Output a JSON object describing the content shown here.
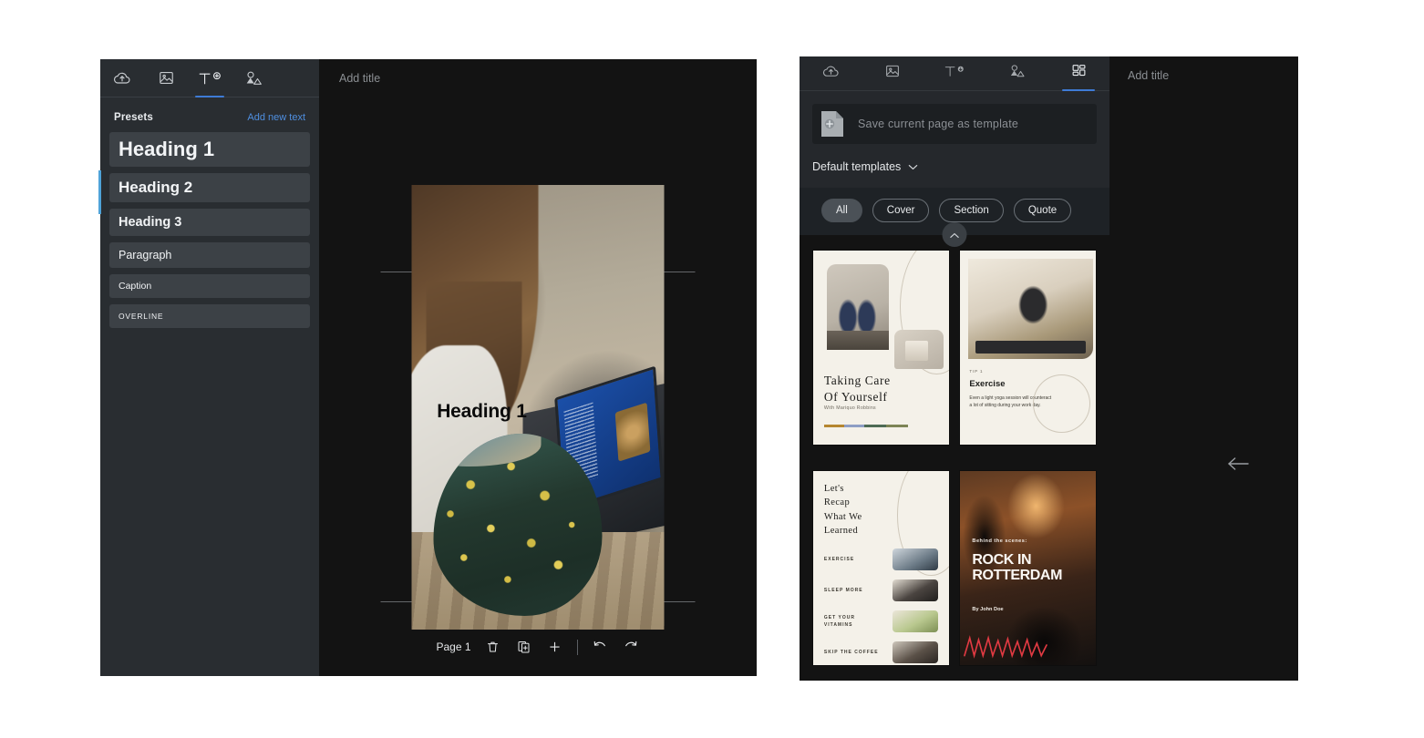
{
  "left_editor": {
    "tabs": [
      {
        "id": "upload",
        "icon": "cloud-upload-icon",
        "active": false
      },
      {
        "id": "images",
        "icon": "image-icon",
        "active": false
      },
      {
        "id": "text",
        "icon": "text-add-icon",
        "active": true
      },
      {
        "id": "shapes",
        "icon": "shapes-icon",
        "active": false
      }
    ],
    "presets_header": {
      "title": "Presets",
      "add_link": "Add new text"
    },
    "presets": [
      {
        "label": "Heading 1",
        "style": "h1"
      },
      {
        "label": "Heading 2",
        "style": "h2"
      },
      {
        "label": "Heading 3",
        "style": "h3"
      },
      {
        "label": "Paragraph",
        "style": "para"
      },
      {
        "label": "Caption",
        "style": "caption"
      },
      {
        "label": "OVERLINE",
        "style": "overline"
      }
    ],
    "canvas": {
      "title_placeholder": "Add title",
      "overlay_heading": "Heading 1"
    },
    "bottom_toolbar": {
      "page_label": "Page 1",
      "delete_icon": "trash-icon",
      "duplicate_icon": "duplicate-page-icon",
      "add_icon": "plus-icon",
      "undo_icon": "undo-icon",
      "redo_icon": "redo-icon"
    }
  },
  "right_editor": {
    "tabs": [
      {
        "id": "upload",
        "icon": "cloud-upload-icon",
        "active": false
      },
      {
        "id": "images",
        "icon": "image-icon",
        "active": false
      },
      {
        "id": "text",
        "icon": "text-download-icon",
        "active": false
      },
      {
        "id": "shapes",
        "icon": "shapes-icon",
        "active": false
      },
      {
        "id": "templates",
        "icon": "grid-templates-icon",
        "active": true
      }
    ],
    "save_row": {
      "icon": "document-plus-icon",
      "label": "Save current page as template"
    },
    "default_templates": {
      "label": "Default templates",
      "chevron": "chevron-down-icon"
    },
    "filters": [
      {
        "label": "All",
        "active": true
      },
      {
        "label": "Cover",
        "active": false
      },
      {
        "label": "Section",
        "active": false
      },
      {
        "label": "Quote",
        "active": false
      }
    ],
    "collapse_button": "chevron-up-icon",
    "templates": [
      {
        "id": "taking-care",
        "title_line1": "Taking Care",
        "title_line2": "Of Yourself",
        "subtitle": "With Mariquo Robbins"
      },
      {
        "id": "exercise-tip",
        "eyebrow": "TIP 1",
        "heading": "Exercise",
        "body": "Even a light yoga session will counteract a lot of sitting during your work day."
      },
      {
        "id": "lets-recap",
        "title": "Let's\nRecap\nWhat We\nLearned",
        "items": [
          "EXERCISE",
          "SLEEP MORE",
          "GET YOUR VITAMINS",
          "SKIP THE COFFEE"
        ]
      },
      {
        "id": "rock-in-rotterdam",
        "eyebrow": "Behind the scenes:",
        "title_line1": "ROCK IN",
        "title_line2": "ROTTERDAM",
        "byline": "By John Doe"
      }
    ],
    "canvas": {
      "title_placeholder": "Add title",
      "back_arrow": "arrow-left-icon"
    }
  },
  "colors": {
    "accent_blue": "#3e7bd6",
    "link_blue": "#4f8fe0",
    "panel_bg_left": "#292d31",
    "panel_bg_right": "#25282c",
    "canvas_bg": "#131313",
    "preset_bg": "#3c4146"
  }
}
